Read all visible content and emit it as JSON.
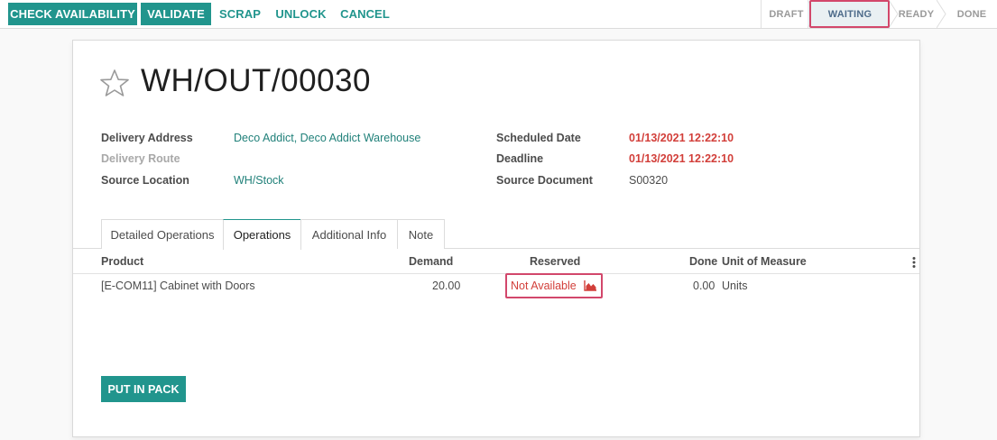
{
  "toolbar": {
    "check_availability": "CHECK AVAILABILITY",
    "validate": "VALIDATE",
    "scrap": "SCRAP",
    "unlock": "UNLOCK",
    "cancel": "CANCEL"
  },
  "statusbar": {
    "stages": [
      "DRAFT",
      "WAITING",
      "READY",
      "DONE"
    ],
    "active_stage": "WAITING"
  },
  "record": {
    "title": "WH/OUT/00030",
    "favorite_icon": "star-outline-icon"
  },
  "fields_left": [
    {
      "label": "Delivery Address",
      "value": "Deco Addict, Deco Addict Warehouse"
    },
    {
      "label": "Delivery Route",
      "value": ""
    },
    {
      "label": "Source Location",
      "value": "WH/Stock"
    }
  ],
  "fields_right": [
    {
      "label": "Scheduled Date",
      "value": "01/13/2021 12:22:10"
    },
    {
      "label": "Deadline",
      "value": "01/13/2021 12:22:10"
    },
    {
      "label": "Source Document",
      "value": "S00320"
    }
  ],
  "tabs": [
    "Detailed Operations",
    "Operations",
    "Additional Info",
    "Note"
  ],
  "active_tab": "Operations",
  "table": {
    "columns": [
      "Product",
      "Demand",
      "Reserved",
      "Done",
      "Unit of Measure"
    ],
    "rows": [
      {
        "product": "[E-COM11] Cabinet with Doors",
        "demand": "20.00",
        "reserved": "Not Available",
        "done": "0.00",
        "uom": "Units"
      }
    ]
  },
  "footer": {
    "put_in_pack": "PUT IN PACK"
  },
  "colors": {
    "primary": "#21958d",
    "link": "#21817a",
    "danger": "#d23f3a",
    "highlight_border": "#d2476b",
    "active_stage_bg": "#e9f0f3"
  }
}
